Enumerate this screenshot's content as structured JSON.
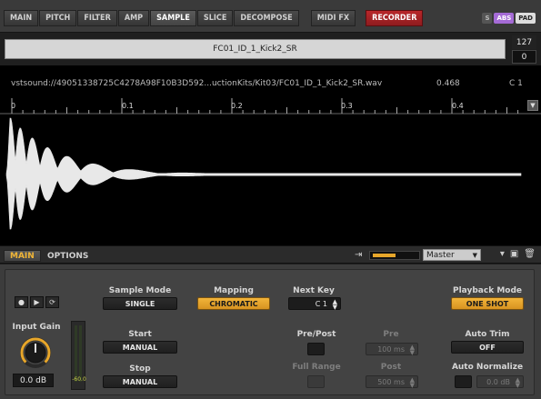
{
  "tabs": [
    {
      "label": "MAIN",
      "active": false
    },
    {
      "label": "PITCH",
      "active": false
    },
    {
      "label": "FILTER",
      "active": false
    },
    {
      "label": "AMP",
      "active": false
    },
    {
      "label": "SAMPLE",
      "active": true
    },
    {
      "label": "SLICE",
      "active": false
    },
    {
      "label": "DECOMPOSE",
      "active": false
    },
    {
      "label": "MIDI FX",
      "active": false
    },
    {
      "label": "RECORDER",
      "active": false
    }
  ],
  "top_icons": {
    "s": "S",
    "abs": "ABS",
    "pad": "PAD"
  },
  "sample": {
    "name": "FC01_ID_1_Kick2_SR",
    "velocity_high": "127",
    "velocity_low": "0",
    "path": "vstsound://49051338725C4278A98F10B3D592...uctionKits/Kit03/FC01_ID_1_Kick2_SR.wav",
    "position": "0.468",
    "root_key": "C 1"
  },
  "ruler": {
    "labels": [
      "0",
      "0.1",
      "0.2",
      "0.3",
      "0.4"
    ],
    "dropdown_icon": "chevron-down-icon"
  },
  "section": {
    "main_tab": "MAIN",
    "options_tab": "OPTIONS",
    "output_bus": "Master",
    "meter_level": 0.5
  },
  "controls": {
    "sample_mode": {
      "label": "Sample Mode",
      "value": "SINGLE"
    },
    "mapping": {
      "label": "Mapping",
      "value": "CHROMATIC"
    },
    "next_key": {
      "label": "Next Key",
      "value": "C 1"
    },
    "playback_mode": {
      "label": "Playback Mode",
      "value": "ONE SHOT"
    },
    "input_gain": {
      "label": "Input Gain",
      "value": "0.0 dB"
    },
    "meter_value": "-60.0",
    "start": {
      "label": "Start",
      "value": "MANUAL"
    },
    "stop": {
      "label": "Stop",
      "value": "MANUAL"
    },
    "pre_post": {
      "label": "Pre/Post"
    },
    "full_range": {
      "label": "Full Range"
    },
    "pre": {
      "label": "Pre",
      "value": "100 ms"
    },
    "post": {
      "label": "Post",
      "value": "500 ms"
    },
    "auto_trim": {
      "label": "Auto Trim",
      "value": "OFF"
    },
    "auto_normalize": {
      "label": "Auto Normalize",
      "value": "0.0 dB"
    }
  },
  "colors": {
    "accent": "#f0b537",
    "recorder": "#b8272a",
    "waveform": "#e8e8e8",
    "abs": "#a56bd6"
  }
}
